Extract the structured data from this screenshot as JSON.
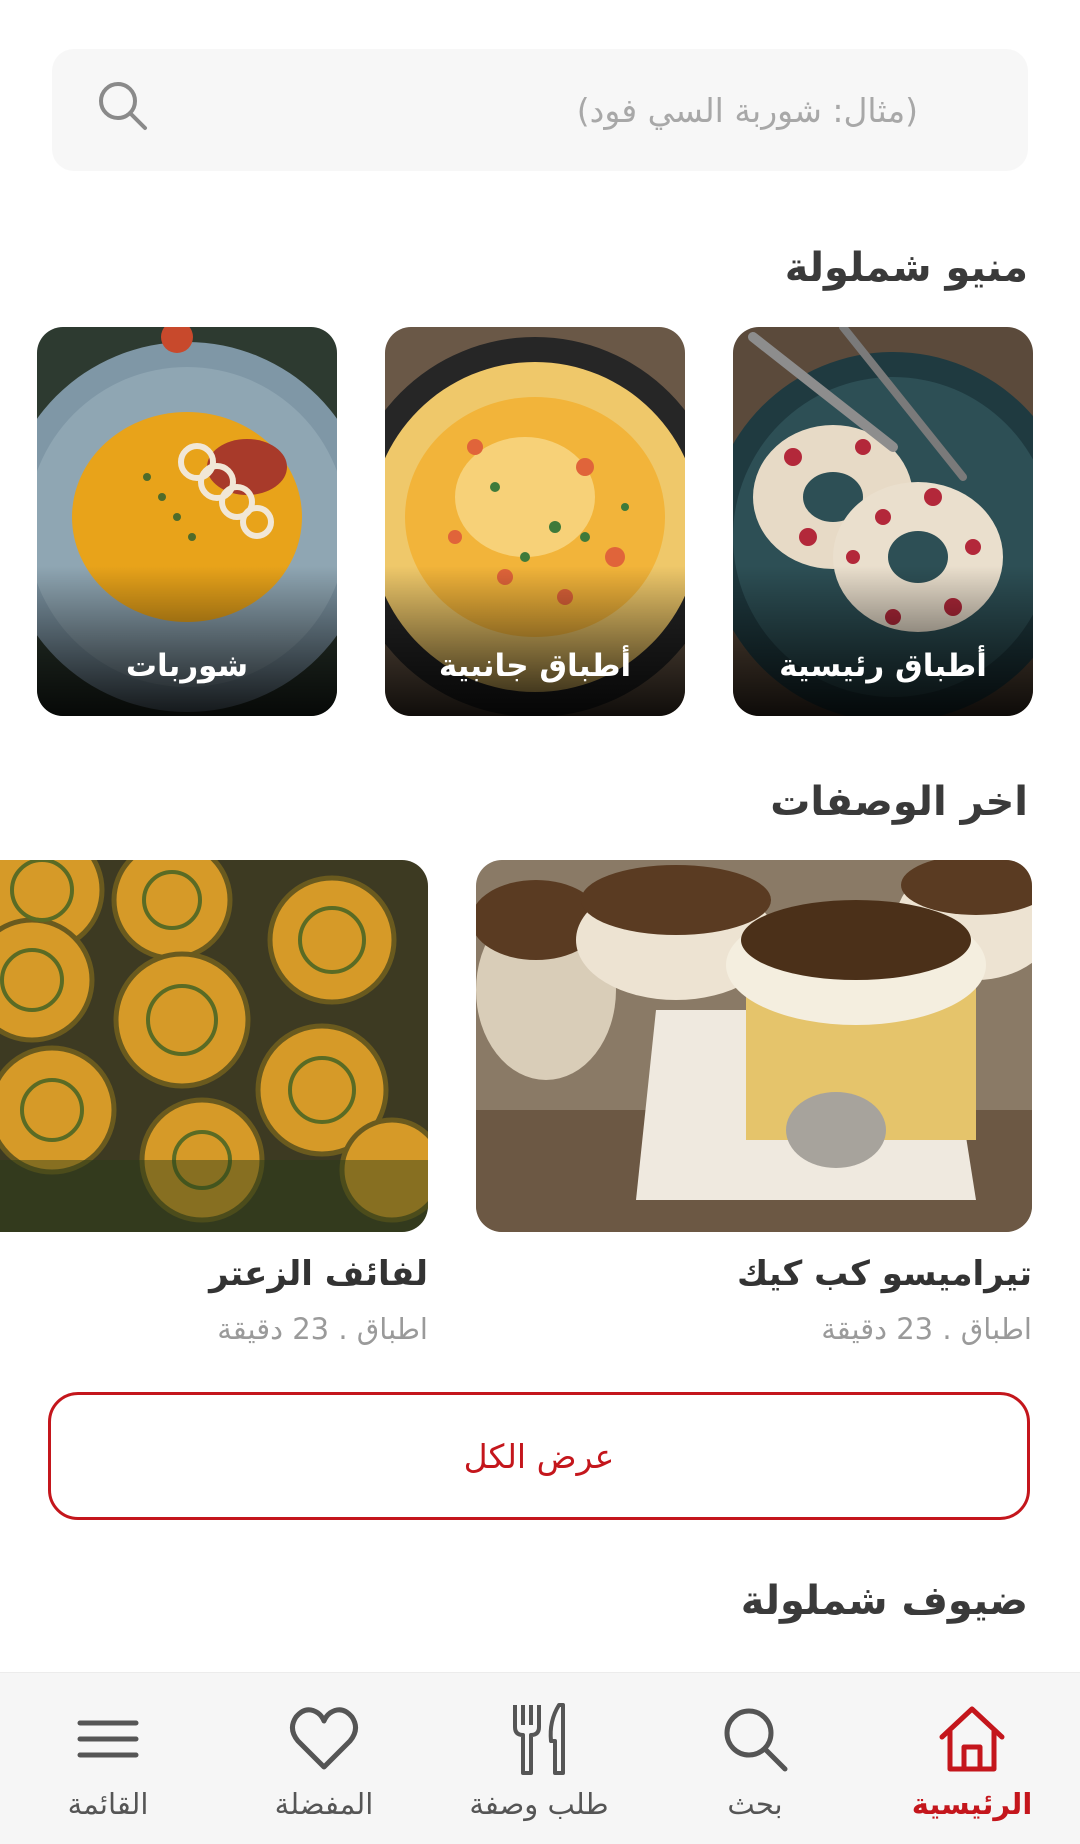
{
  "search": {
    "placeholder": "(مثال: شوربة السي فود)",
    "icon": "search-icon"
  },
  "menu_section": {
    "title": "منيو شملولة",
    "items": [
      {
        "label": "أطباق رئيسية"
      },
      {
        "label": "أطباق جانبية"
      },
      {
        "label": "شوربات"
      }
    ]
  },
  "recipes_section": {
    "title": "اخر الوصفات",
    "items": [
      {
        "title": "تيراميسو كب كيك",
        "meta": "اطباق . 23 دقيقة"
      },
      {
        "title": "لفائف الزعتر",
        "meta": "اطباق . 23 دقيقة"
      }
    ],
    "view_all_label": "عرض الكل"
  },
  "guests_section": {
    "title": "ضيوف شملولة"
  },
  "bottom_nav": {
    "active_color": "#c4161c",
    "items": [
      {
        "label": "الرئيسية",
        "icon": "home-icon",
        "active": true
      },
      {
        "label": "بحث",
        "icon": "search-icon",
        "active": false
      },
      {
        "label": "طلب وصفة",
        "icon": "fork-knife-icon",
        "active": false
      },
      {
        "label": "المفضلة",
        "icon": "heart-icon",
        "active": false
      },
      {
        "label": "القائمة",
        "icon": "menu-icon",
        "active": false
      }
    ]
  },
  "colors": {
    "accent": "#c4161c",
    "search_background": "#f7f7f7",
    "nav_background": "#f6f6f6"
  }
}
